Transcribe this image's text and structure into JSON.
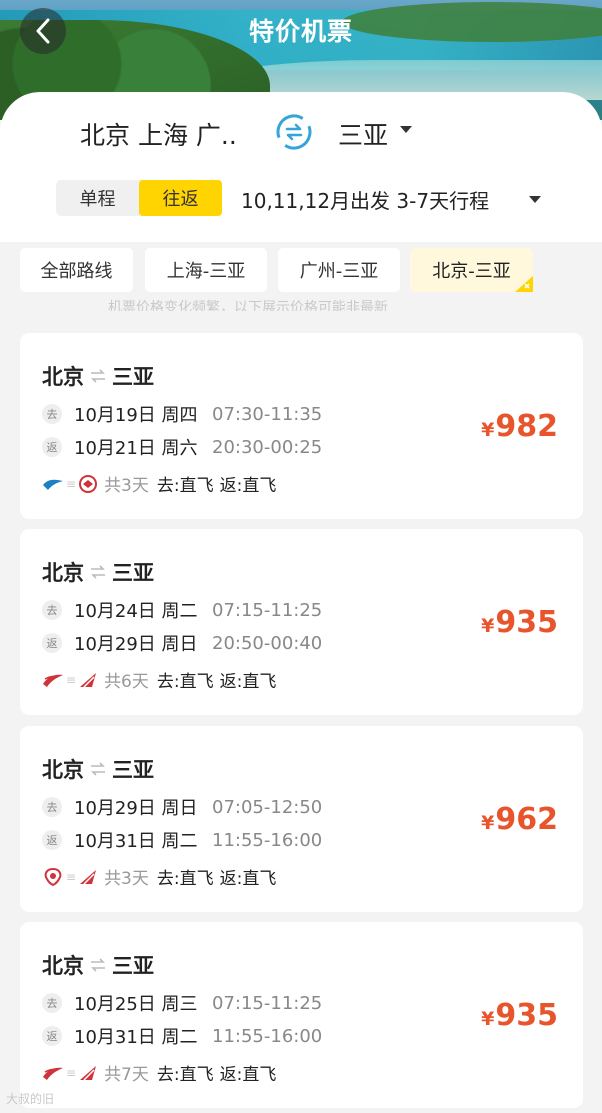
{
  "header": {
    "title": "特价机票"
  },
  "search": {
    "from": "北京 上海 广..",
    "to": "三亚",
    "trip_types": [
      "单程",
      "往返"
    ],
    "active_trip_type": "往返",
    "filter": "10,11,12月出发 3-7天行程"
  },
  "route_tabs": [
    "全部路线",
    "上海-三亚",
    "广州-三亚",
    "北京-三亚"
  ],
  "active_route_tab": "北京-三亚",
  "notice": "机票价格变化频繁，以下展示价格可能非最新",
  "go_tag": "去",
  "return_tag": "返",
  "flights": [
    {
      "from": "北京",
      "to": "三亚",
      "out_date": "10月19日 周四",
      "out_time": "07:30-11:35",
      "ret_date": "10月21日 周六",
      "ret_time": "20:30-00:25",
      "days": "共3天",
      "out_type": "去:直飞",
      "ret_type": "返:直飞",
      "currency": "¥",
      "price": "982",
      "airlines": [
        "xiamen-airlines-icon",
        "sichuan-airlines-icon"
      ]
    },
    {
      "from": "北京",
      "to": "三亚",
      "out_date": "10月24日 周二",
      "out_time": "07:15-11:25",
      "ret_date": "10月29日 周日",
      "ret_time": "20:50-00:40",
      "days": "共6天",
      "out_type": "去:直飞",
      "ret_type": "返:直飞",
      "currency": "¥",
      "price": "935",
      "airlines": [
        "shanghai-airlines-icon",
        "shenzhen-airlines-icon"
      ]
    },
    {
      "from": "北京",
      "to": "三亚",
      "out_date": "10月29日 周日",
      "out_time": "07:05-12:50",
      "ret_date": "10月31日 周二",
      "ret_time": "11:55-16:00",
      "days": "共3天",
      "out_type": "去:直飞",
      "ret_type": "返:直飞",
      "currency": "¥",
      "price": "962",
      "airlines": [
        "hainan-airlines-icon",
        "shenzhen-airlines-icon"
      ]
    },
    {
      "from": "北京",
      "to": "三亚",
      "out_date": "10月25日 周三",
      "out_time": "07:15-11:25",
      "ret_date": "10月31日 周二",
      "ret_time": "11:55-16:00",
      "days": "共7天",
      "out_type": "去:直飞",
      "ret_type": "返:直飞",
      "currency": "¥",
      "price": "935",
      "airlines": [
        "shanghai-airlines-icon",
        "shenzhen-airlines-icon"
      ]
    }
  ],
  "watermark": "大叔的旧",
  "colors": {
    "accent": "#ffd400",
    "price": "#e8542c",
    "swap": "#35a5d9"
  }
}
